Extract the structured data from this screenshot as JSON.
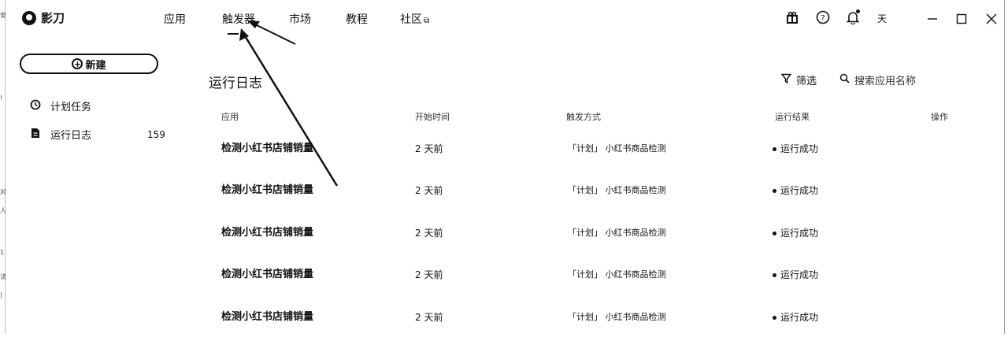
{
  "app": {
    "name": "影刀"
  },
  "nav": [
    {
      "label": "应用"
    },
    {
      "label": "触发器"
    },
    {
      "label": "市场"
    },
    {
      "label": "教程"
    },
    {
      "label": "社区"
    }
  ],
  "top_icons": [
    "gift-icon",
    "help-icon",
    "bell-icon"
  ],
  "user": {
    "label": "天"
  },
  "sidebar": {
    "new_button": "新建",
    "items": [
      {
        "label": "计划任务",
        "icon": "clock-icon"
      },
      {
        "label": "运行日志",
        "icon": "file-icon",
        "count": "159"
      }
    ]
  },
  "main": {
    "title": "运行日志",
    "filter_label": "筛选",
    "search_placeholder": "搜索应用名称",
    "columns": [
      "应用",
      "开始时间",
      "触发方式",
      "运行结果",
      "操作"
    ],
    "rows": [
      {
        "name": "检测小红书店铺销量",
        "time": "2 天前",
        "trigger": "「计划」 小红书商品检测",
        "result": "运行成功"
      },
      {
        "name": "检测小红书店铺销量",
        "time": "2 天前",
        "trigger": "「计划」 小红书商品检测",
        "result": "运行成功"
      },
      {
        "name": "检测小红书店铺销量",
        "time": "2 天前",
        "trigger": "「计划」 小红书商品检测",
        "result": "运行成功"
      },
      {
        "name": "检测小红书店铺销量",
        "time": "2 天前",
        "trigger": "「计划」 小红书商品检测",
        "result": "运行成功"
      },
      {
        "name": "检测小红书店铺销量",
        "time": "2 天前",
        "trigger": "「计划」 小红书商品检测",
        "result": "运行成功"
      }
    ]
  }
}
